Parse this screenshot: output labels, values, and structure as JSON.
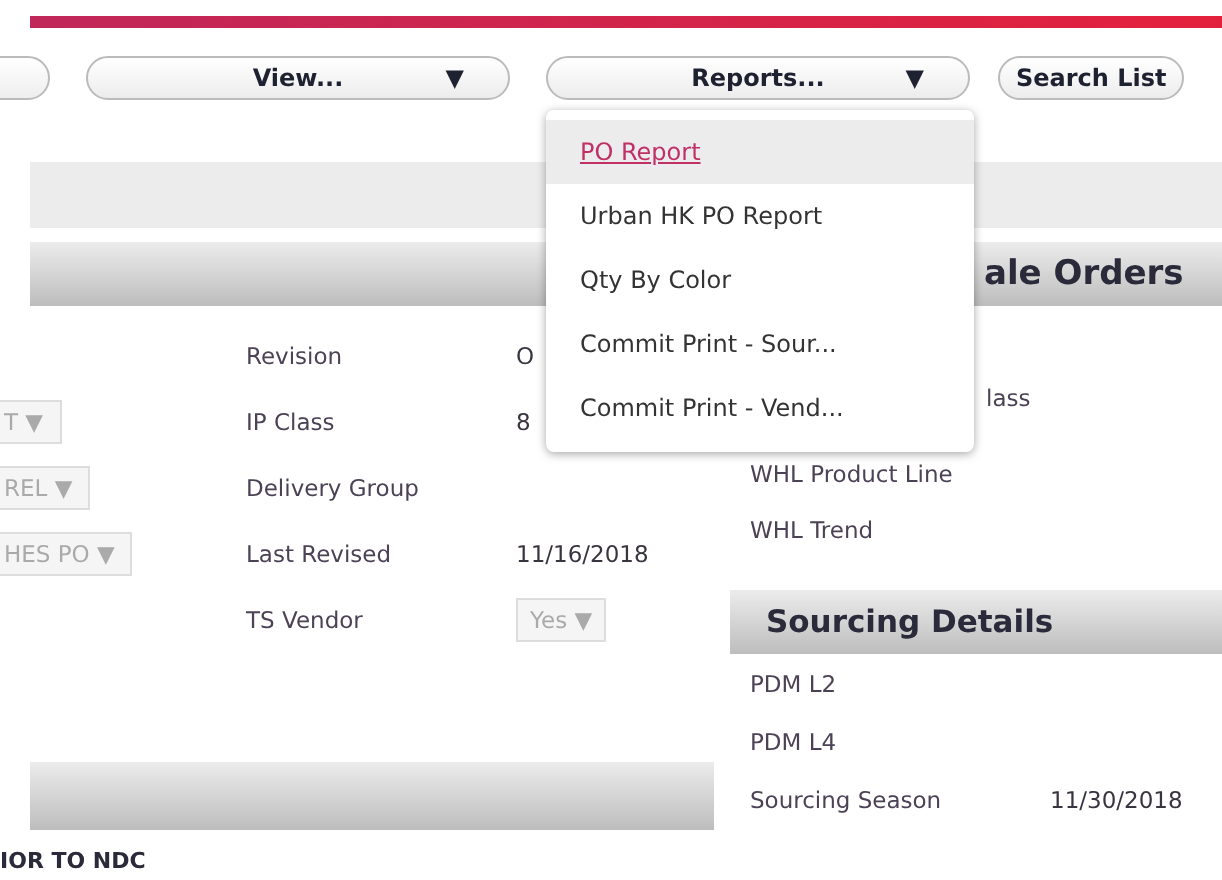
{
  "toolbar": {
    "buttons": [
      {
        "label": "View...",
        "kind": "dropdown",
        "caret": "▼"
      },
      {
        "label": "Reports...",
        "kind": "dropdown",
        "caret": "▼"
      },
      {
        "label": "Search List",
        "kind": "plain"
      }
    ]
  },
  "reports_menu": {
    "items": [
      {
        "label": "PO Report",
        "selected": true
      },
      {
        "label": "Urban HK PO Report",
        "selected": false
      },
      {
        "label": "Qty By Color",
        "selected": false
      },
      {
        "label": "Commit Print - Sour...",
        "selected": false
      },
      {
        "label": "Commit Print - Vend...",
        "selected": false
      }
    ]
  },
  "left_panel": {
    "rows": [
      {
        "label": "Revision",
        "value": "O",
        "kind": "text"
      },
      {
        "select": "T ▼",
        "label": "IP Class",
        "value": "8",
        "kind": "text"
      },
      {
        "select": "REL ▼",
        "label": "Delivery Group",
        "kind": "text"
      },
      {
        "select": "HES PO ▼",
        "label": "Last Revised",
        "value": "11/16/2018",
        "kind": "text"
      },
      {
        "label": "TS Vendor",
        "value": "Yes ▼",
        "kind": "select"
      }
    ],
    "footer_text": "IOR TO NDC"
  },
  "right_panel": {
    "title": "ale Orders",
    "fields": [
      "lass",
      "WHL Product Line",
      "WHL Trend"
    ],
    "sourcing": {
      "title": "Sourcing Details",
      "rows": [
        {
          "label": "PDM L2"
        },
        {
          "label": "PDM L4"
        },
        {
          "label": "Sourcing Season",
          "value": "11/30/2018"
        }
      ]
    }
  }
}
